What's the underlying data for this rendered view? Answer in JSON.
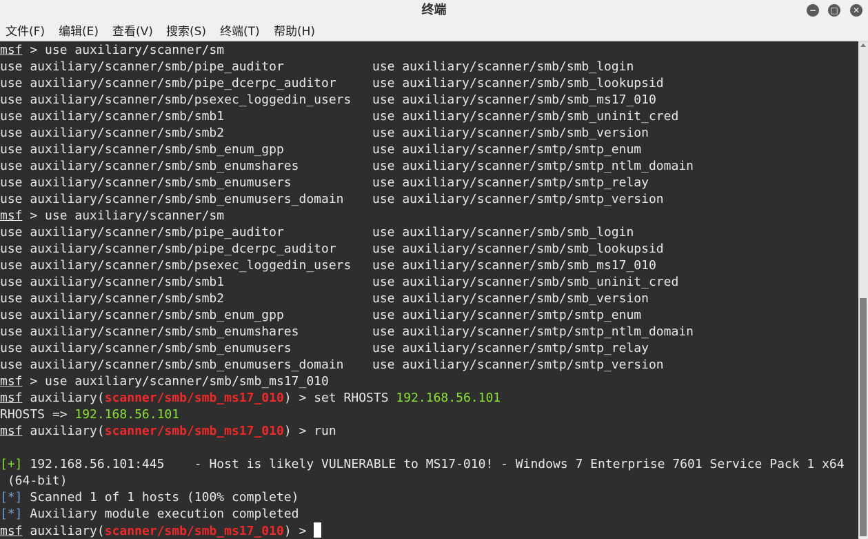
{
  "window": {
    "title": "终端",
    "minimize_symbol": "−",
    "maximize_symbol": "□",
    "close_symbol": "✕"
  },
  "menu": [
    "文件(F)",
    "编辑(E)",
    "查看(V)",
    "搜索(S)",
    "终端(T)",
    "帮助(H)"
  ],
  "prompt": "msf",
  "module": "scanner/smb/smb_ms17_010",
  "commands": {
    "use_partial": "use auxiliary/scanner/sm",
    "use_full": "use auxiliary/scanner/smb/smb_ms17_010",
    "set_prefix": "set RHOSTS ",
    "run": "run"
  },
  "completions_left": [
    "use auxiliary/scanner/smb/pipe_auditor",
    "use auxiliary/scanner/smb/pipe_dcerpc_auditor",
    "use auxiliary/scanner/smb/psexec_loggedin_users",
    "use auxiliary/scanner/smb/smb1",
    "use auxiliary/scanner/smb/smb2",
    "use auxiliary/scanner/smb/smb_enum_gpp",
    "use auxiliary/scanner/smb/smb_enumshares",
    "use auxiliary/scanner/smb/smb_enumusers",
    "use auxiliary/scanner/smb/smb_enumusers_domain"
  ],
  "completions_right": [
    "use auxiliary/scanner/smb/smb_login",
    "use auxiliary/scanner/smb/smb_lookupsid",
    "use auxiliary/scanner/smb/smb_ms17_010",
    "use auxiliary/scanner/smb/smb_uninit_cred",
    "use auxiliary/scanner/smb/smb_version",
    "use auxiliary/scanner/smtp/smtp_enum",
    "use auxiliary/scanner/smtp/smtp_ntlm_domain",
    "use auxiliary/scanner/smtp/smtp_relay",
    "use auxiliary/scanner/smtp/smtp_version"
  ],
  "rhosts_ip": "192.168.56.101",
  "rhosts_echo": "RHOSTS => ",
  "result": {
    "tag": "[+]",
    "host": "192.168.56.101:445",
    "message": "    - Host is likely VULNERABLE to MS17-010! - Windows 7 Enterprise 7601 Service Pack 1 x64",
    "continuation": " (64-bit)"
  },
  "status1": {
    "tag": "[*]",
    "text": " Scanned 1 of 1 hosts (100% complete)"
  },
  "status2": {
    "tag": "[*]",
    "text": " Auxiliary module execution completed"
  },
  "colors": {
    "green": "#8ae234",
    "red": "#ef2929",
    "blue": "#729fcf",
    "background": "#2e2e2e"
  }
}
